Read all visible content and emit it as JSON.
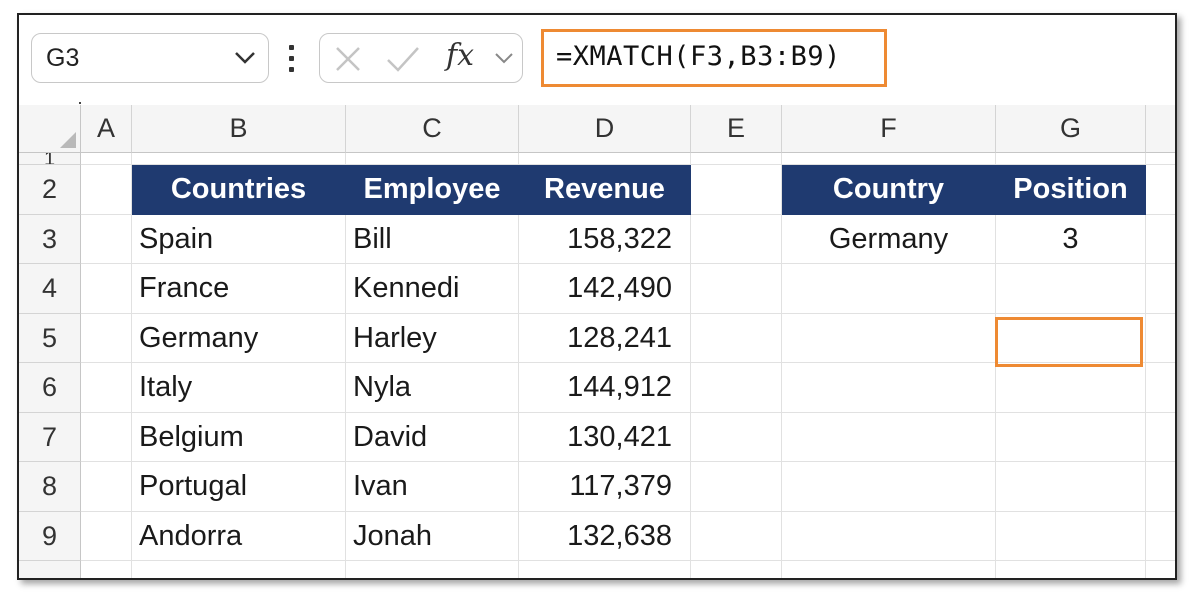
{
  "formula_bar": {
    "name_box": "G3",
    "fx_label": "fx",
    "formula": "=XMATCH(F3,B3:B9)"
  },
  "columns": [
    "A",
    "B",
    "C",
    "D",
    "E",
    "F",
    "G"
  ],
  "rows": [
    "1",
    "2",
    "3",
    "4",
    "5",
    "6",
    "7",
    "8",
    "9"
  ],
  "table": {
    "headers": [
      "Countries",
      "Employee",
      "Revenue"
    ],
    "rows": [
      [
        "Spain",
        "Bill",
        "158,322"
      ],
      [
        "France",
        "Kennedi",
        "142,490"
      ],
      [
        "Germany",
        "Harley",
        "128,241"
      ],
      [
        "Italy",
        "Nyla",
        "144,912"
      ],
      [
        "Belgium",
        "David",
        "130,421"
      ],
      [
        "Portugal",
        "Ivan",
        "117,379"
      ],
      [
        "Andorra",
        "Jonah",
        "132,638"
      ]
    ]
  },
  "lookup": {
    "headers": [
      "Country",
      "Position"
    ],
    "country": "Germany",
    "position": "3"
  },
  "colors": {
    "header_fill": "#1f3a70",
    "highlight_border": "#ee8a33"
  }
}
